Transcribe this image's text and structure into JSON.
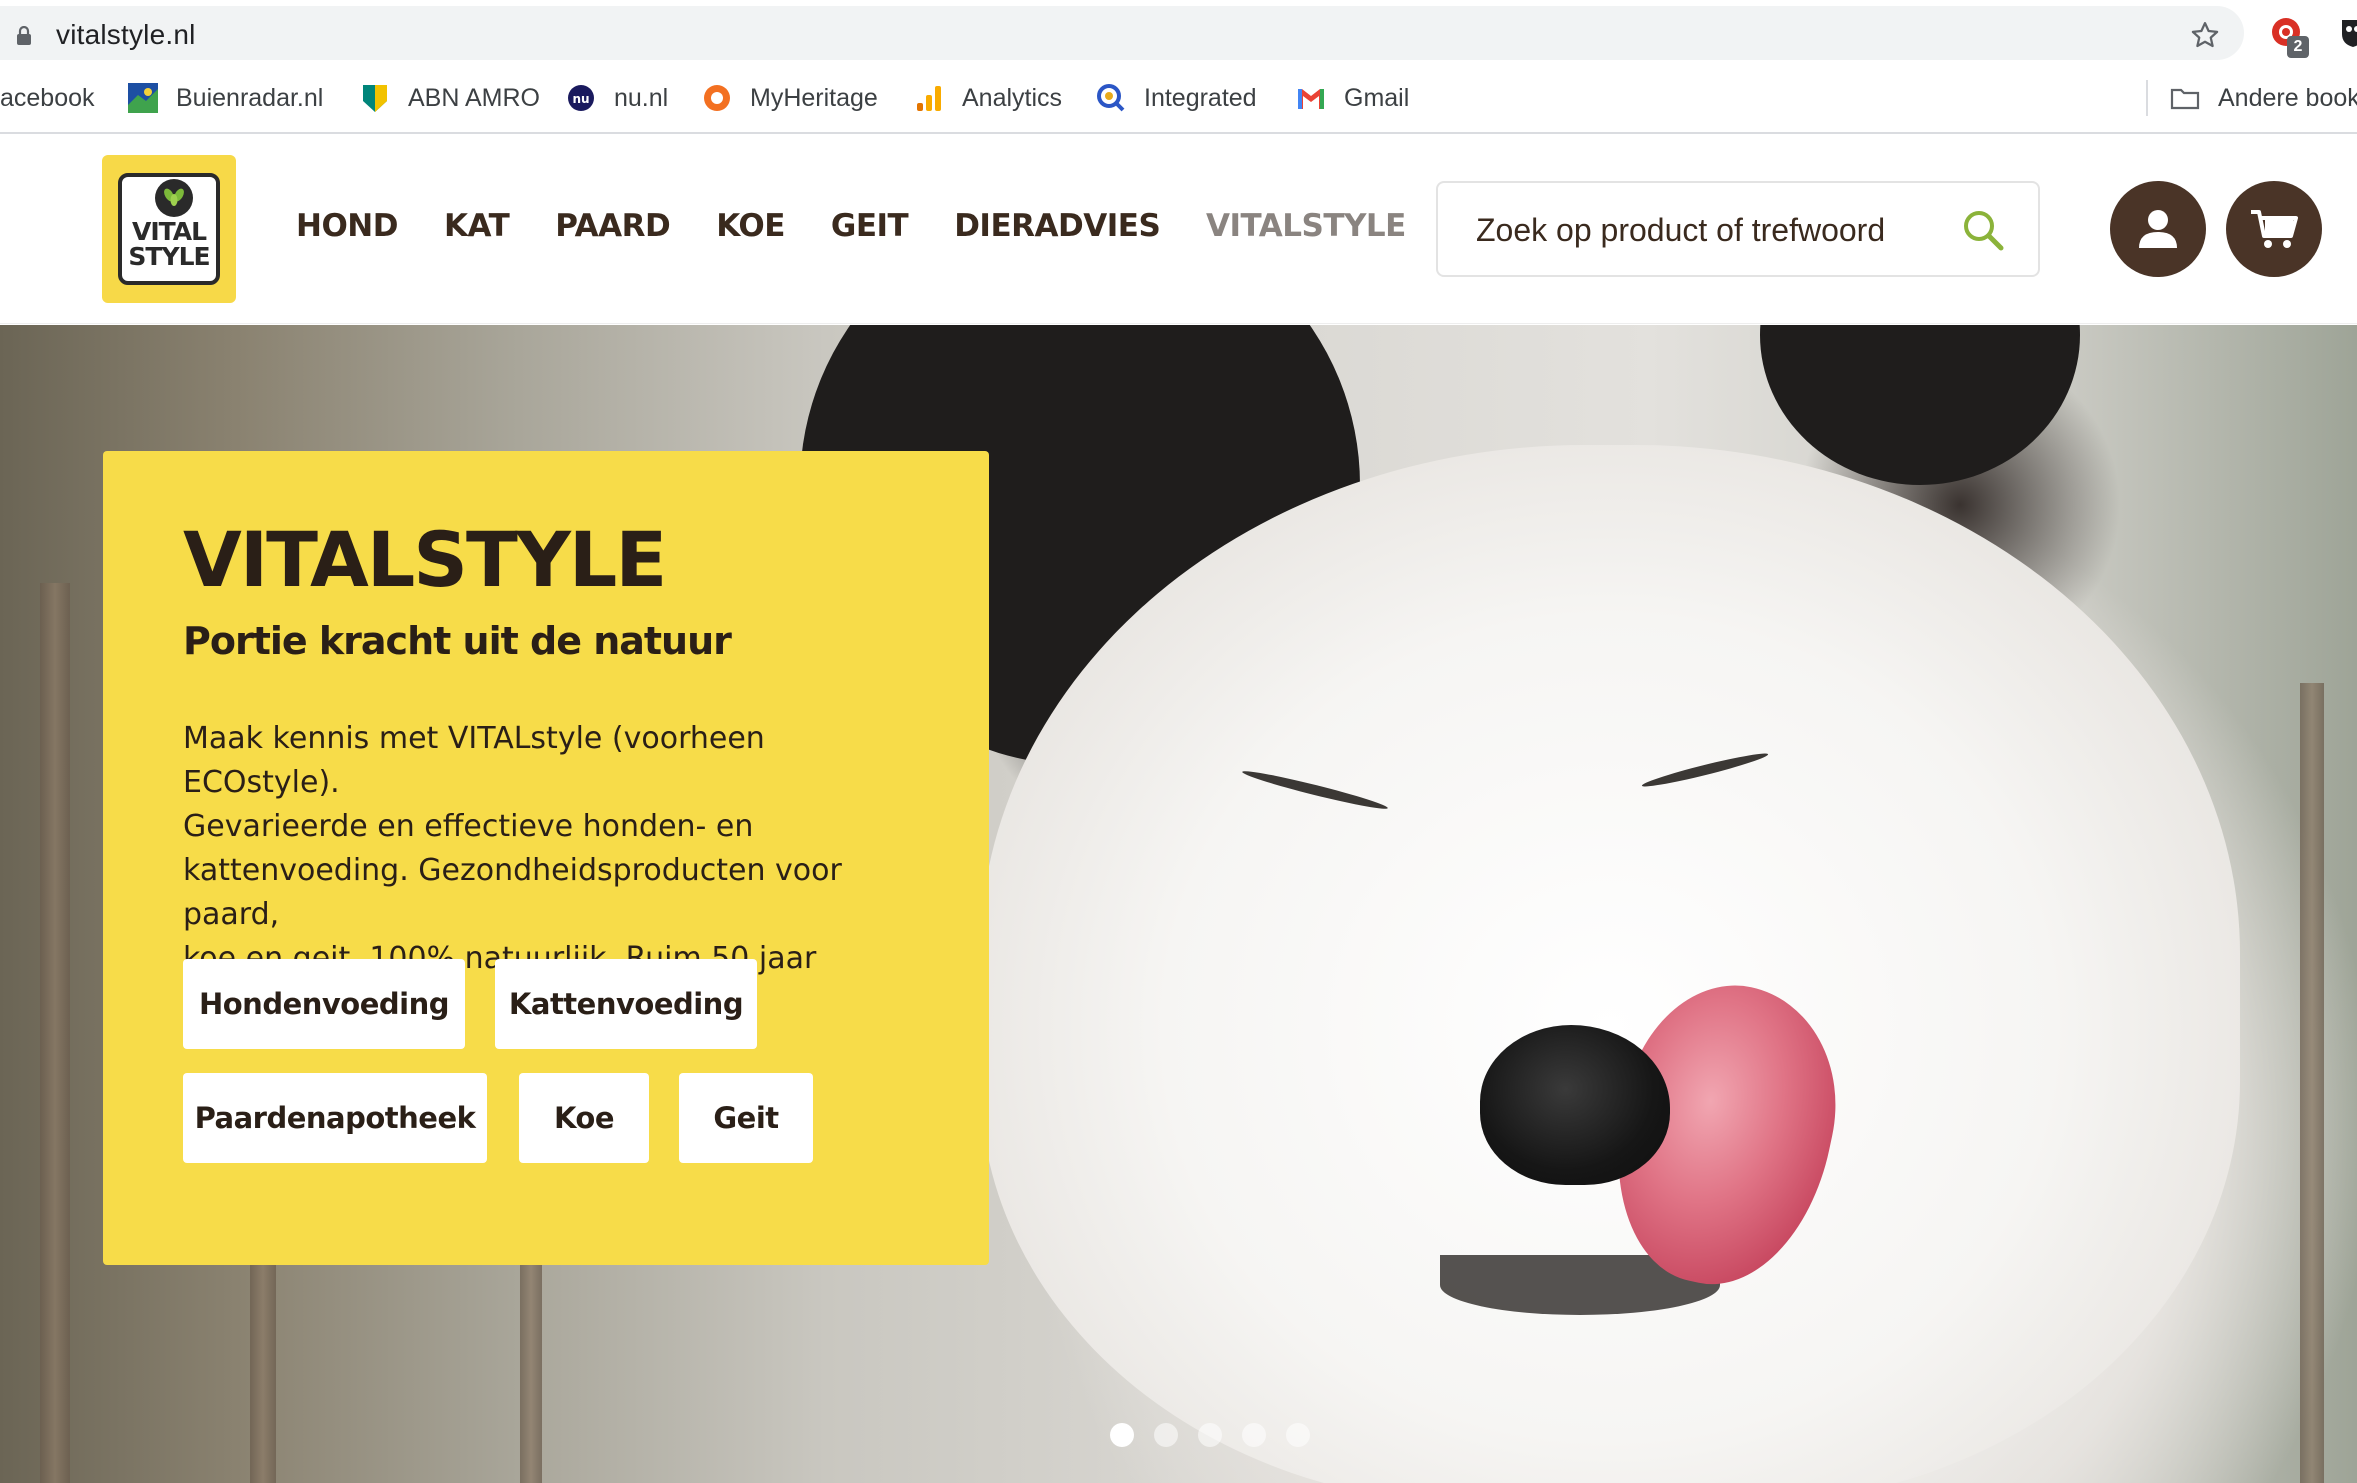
{
  "browser": {
    "url": "vitalstyle.nl",
    "extension_badge": "2",
    "bookmarks": [
      {
        "label": "acebook",
        "icon": "facebook-icon"
      },
      {
        "label": "Buienradar.nl",
        "icon": "buienradar-icon"
      },
      {
        "label": "ABN AMRO",
        "icon": "abn-amro-icon"
      },
      {
        "label": "nu.nl",
        "icon": "nu-nl-icon"
      },
      {
        "label": "MyHeritage",
        "icon": "myheritage-icon"
      },
      {
        "label": "Analytics",
        "icon": "analytics-icon"
      },
      {
        "label": "Integrated",
        "icon": "integrated-icon"
      },
      {
        "label": "Gmail",
        "icon": "gmail-icon"
      }
    ],
    "other_bookmarks": "Andere book"
  },
  "header": {
    "logo_text": [
      "VITAL",
      "STYLE"
    ],
    "nav": [
      "HOND",
      "KAT",
      "PAARD",
      "KOE",
      "GEIT",
      "DIERADVIES"
    ],
    "nav_active": "VITALSTYLE",
    "search_placeholder": "Zoek op product of trefwoord"
  },
  "hero": {
    "title": "VITALSTYLE",
    "subtitle": "Portie kracht uit de natuur",
    "body_lines": [
      "Maak kennis met VITALstyle (voorheen ECOstyle).",
      "Gevarieerde en effectieve honden- en",
      "kattenvoeding. Gezondheidsproducten voor paard,",
      "koe en geit. 100% natuurlijk. Ruim 50 jaar ervaring."
    ],
    "buttons": [
      "Hondenvoeding",
      "Kattenvoeding",
      "Paardenapotheek",
      "Koe",
      "Geit"
    ],
    "slides_total": 5,
    "slide_active": 1
  },
  "colors": {
    "brand_yellow": "#f7dc49",
    "brand_brown": "#4a3427",
    "search_icon_green": "#8bb33a"
  }
}
